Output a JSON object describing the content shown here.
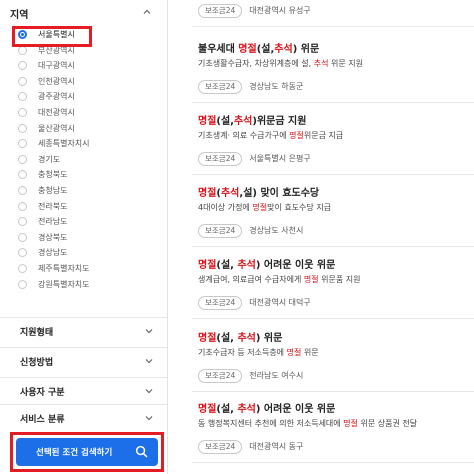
{
  "sidebar": {
    "region_title": "지역",
    "regions": [
      {
        "label": "서울특별시",
        "selected": true
      },
      {
        "label": "부산광역시",
        "selected": false
      },
      {
        "label": "대구광역시",
        "selected": false
      },
      {
        "label": "인천광역시",
        "selected": false
      },
      {
        "label": "광주광역시",
        "selected": false
      },
      {
        "label": "대전광역시",
        "selected": false
      },
      {
        "label": "울산광역시",
        "selected": false
      },
      {
        "label": "세종특별자치시",
        "selected": false
      },
      {
        "label": "경기도",
        "selected": false
      },
      {
        "label": "충청북도",
        "selected": false
      },
      {
        "label": "충청남도",
        "selected": false
      },
      {
        "label": "전라북도",
        "selected": false
      },
      {
        "label": "전라남도",
        "selected": false
      },
      {
        "label": "경상북도",
        "selected": false
      },
      {
        "label": "경상남도",
        "selected": false
      },
      {
        "label": "제주특별자치도",
        "selected": false
      },
      {
        "label": "강원특별자치도",
        "selected": false
      }
    ],
    "facets": [
      {
        "label": "지원형태"
      },
      {
        "label": "신청방법"
      },
      {
        "label": "사용자 구분"
      },
      {
        "label": "서비스 분류"
      }
    ],
    "search_button_label": "선택된 조건 검색하기",
    "highlight_color": "#e51c23",
    "accent_color": "#1c6fe8"
  },
  "results": [
    {
      "title_parts": [],
      "desc_parts": [],
      "badge": "보조금24",
      "region": "대전광역시 유성구"
    },
    {
      "title_parts": [
        [
          "불우세대 ",
          false
        ],
        [
          "명절",
          true
        ],
        [
          "(설,",
          false
        ],
        [
          "추석",
          true
        ],
        [
          ") 위문",
          false
        ]
      ],
      "desc_parts": [
        [
          "기초생활수급자, 차상위계층에 설, ",
          false
        ],
        [
          "추석",
          true
        ],
        [
          " 위문 지원",
          false
        ]
      ],
      "badge": "보조금24",
      "region": "경상남도 하동군"
    },
    {
      "title_parts": [
        [
          "명절",
          true
        ],
        [
          "(설,",
          false
        ],
        [
          "추석",
          true
        ],
        [
          ")위문금 지원",
          false
        ]
      ],
      "desc_parts": [
        [
          "기초생계· 의료 수급가구에 ",
          false
        ],
        [
          "명절",
          true
        ],
        [
          "위문금 지급",
          false
        ]
      ],
      "badge": "보조금24",
      "region": "서울특별시 은평구"
    },
    {
      "title_parts": [
        [
          "명절",
          true
        ],
        [
          "(",
          false
        ],
        [
          "추석",
          true
        ],
        [
          ",설) 맞이 효도수당",
          false
        ]
      ],
      "desc_parts": [
        [
          "4대이상 가정에 ",
          false
        ],
        [
          "명절",
          true
        ],
        [
          "맞이 효도수당 지급",
          false
        ]
      ],
      "badge": "보조금24",
      "region": "경상남도 사천시"
    },
    {
      "title_parts": [
        [
          "명절",
          true
        ],
        [
          "(설, ",
          false
        ],
        [
          "추석",
          true
        ],
        [
          ") 어려운 이웃 위문",
          false
        ]
      ],
      "desc_parts": [
        [
          "생계급여, 의료급여 수급자에게 ",
          false
        ],
        [
          "명절",
          true
        ],
        [
          " 위문품 지원",
          false
        ]
      ],
      "badge": "보조금24",
      "region": "대전광역시 대덕구"
    },
    {
      "title_parts": [
        [
          "명절",
          true
        ],
        [
          "(설, ",
          false
        ],
        [
          "추석",
          true
        ],
        [
          ") 위문",
          false
        ]
      ],
      "desc_parts": [
        [
          "기초수급자 등 저소득층에 ",
          false
        ],
        [
          "명절",
          true
        ],
        [
          " 위문",
          false
        ]
      ],
      "badge": "보조금24",
      "region": "전라남도 여수시"
    },
    {
      "title_parts": [
        [
          "명절",
          true
        ],
        [
          "(설, ",
          false
        ],
        [
          "추석",
          true
        ],
        [
          ") 어려운 이웃 위문",
          false
        ]
      ],
      "desc_parts": [
        [
          "동 행정복지센터 추천에 의한 저소득세대에 ",
          false
        ],
        [
          "명절",
          true
        ],
        [
          " 위문 상품권 전달",
          false
        ]
      ],
      "badge": "보조금24",
      "region": "대전광역시 동구"
    }
  ]
}
